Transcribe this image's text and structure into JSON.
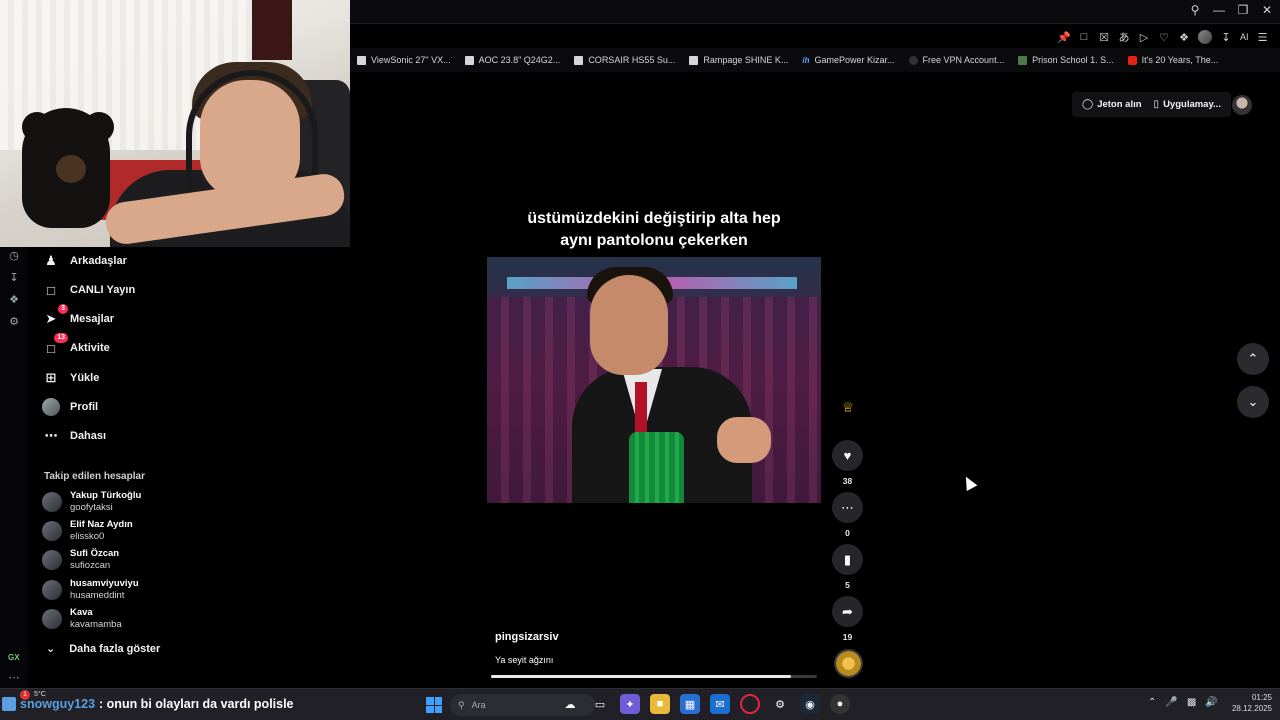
{
  "browser": {
    "bookmarks": [
      {
        "label": "ViewSonic 27\" VX...",
        "icon": "bookmark-icon"
      },
      {
        "label": "AOC 23.8\" Q24G2...",
        "icon": "bookmark-icon"
      },
      {
        "label": "CORSAIR HS55 Su...",
        "icon": "bookmark-icon"
      },
      {
        "label": "Rampage SHINE K...",
        "icon": "bookmark-icon"
      },
      {
        "label": "GamePower Kizar...",
        "icon": "gamepower-icon"
      },
      {
        "label": "Free VPN Account...",
        "icon": "vpn-icon"
      },
      {
        "label": "Prison School 1. S...",
        "icon": "site-icon"
      },
      {
        "label": "It's 20 Years, The...",
        "icon": "youtube-icon"
      }
    ],
    "ai_label": "AI"
  },
  "sidebar": {
    "items": [
      {
        "label": "Arkadaşlar",
        "icon": "friends-icon",
        "badge": ""
      },
      {
        "label": "CANLI Yayın",
        "icon": "live-icon",
        "badge": ""
      },
      {
        "label": "Mesajlar",
        "icon": "messages-icon",
        "badge": "3"
      },
      {
        "label": "Aktivite",
        "icon": "activity-icon",
        "badge": "13"
      },
      {
        "label": "Yükle",
        "icon": "upload-icon",
        "badge": ""
      },
      {
        "label": "Profil",
        "icon": "profile-icon",
        "badge": ""
      },
      {
        "label": "Dahası",
        "icon": "more-icon",
        "badge": ""
      }
    ],
    "following_title": "Takip edilen hesaplar",
    "following": [
      {
        "name": "Yakup Türkoğlu",
        "username": "goofytaksi"
      },
      {
        "name": "Elif Naz Aydın",
        "username": "elissko0"
      },
      {
        "name": "Sufi Özcan",
        "username": "sufiozcan"
      },
      {
        "name": "husamviyuviyu",
        "username": "husameddint"
      },
      {
        "name": "Kava",
        "username": "kavamamba"
      }
    ],
    "show_more": "Daha fazla göster",
    "rail_label": "GX"
  },
  "header": {
    "coins": "Jeton alın",
    "app": "Uygulamay..."
  },
  "video": {
    "caption_line1": "üstümüzdekini değiştirip alta hep",
    "caption_line2": "aynı pantolonu çekerken",
    "username": "pingsizarsiv",
    "description": "Ya seyit ağzını",
    "progress": 0.92,
    "likes": "38",
    "comments": "0",
    "saves": "5",
    "shares": "19"
  },
  "taskbar": {
    "chat_user": "snowguy123",
    "chat_message": ": onun bi olayları da vardı polisle",
    "weather": "5°C",
    "weather_badge": "1",
    "search_placeholder": "Ara",
    "time": "01:25",
    "date": "28.12.2025"
  }
}
